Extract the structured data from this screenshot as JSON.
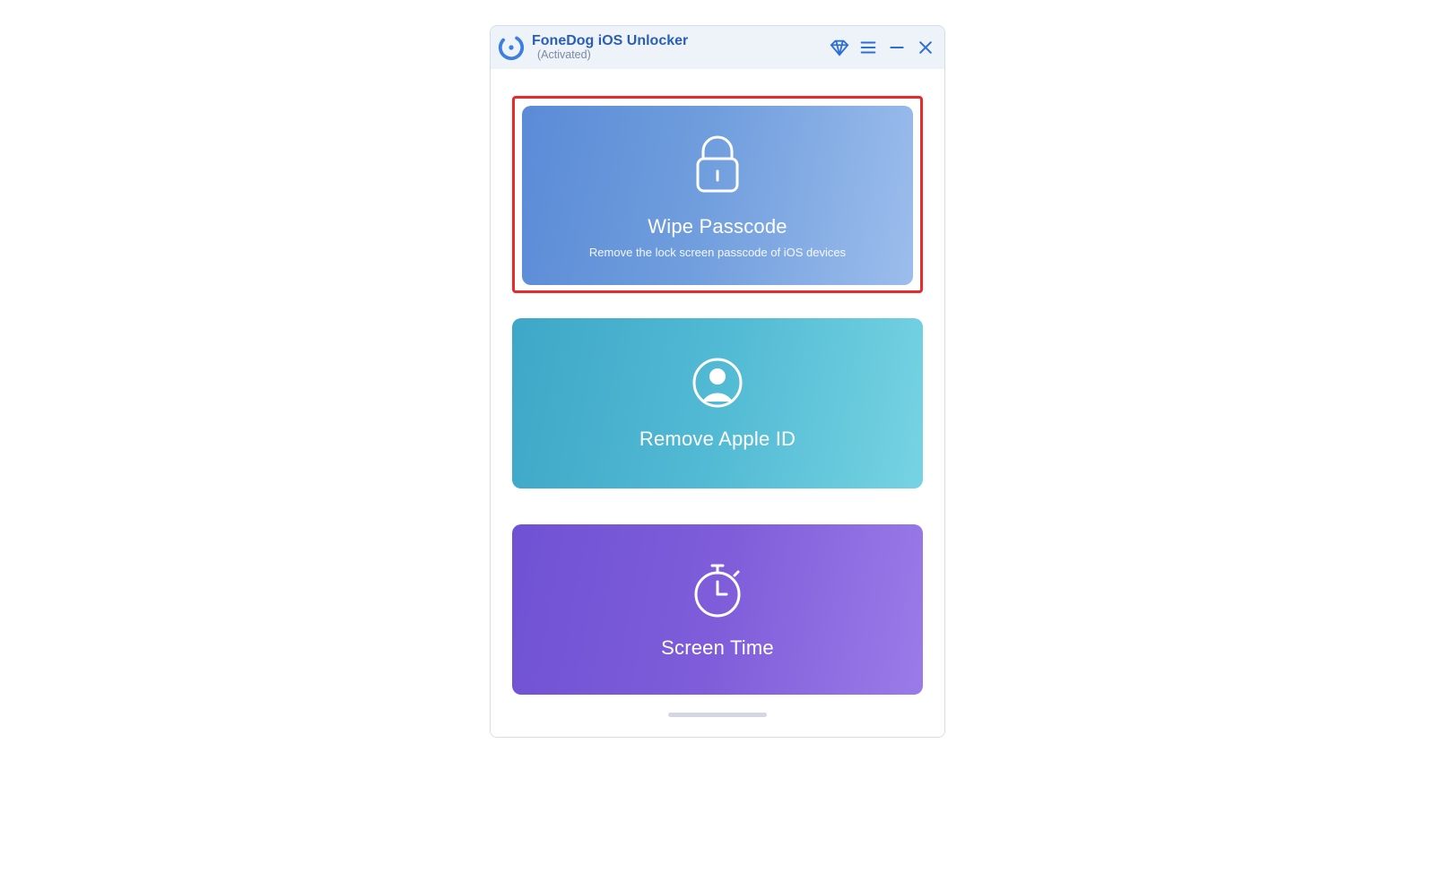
{
  "titlebar": {
    "app_title": "FoneDog iOS Unlocker",
    "status": "(Activated)"
  },
  "cards": {
    "wipe": {
      "title": "Wipe Passcode",
      "subtitle": "Remove the lock screen passcode of iOS devices"
    },
    "apple_id": {
      "title": "Remove Apple ID"
    },
    "screen_time": {
      "title": "Screen Time"
    }
  }
}
